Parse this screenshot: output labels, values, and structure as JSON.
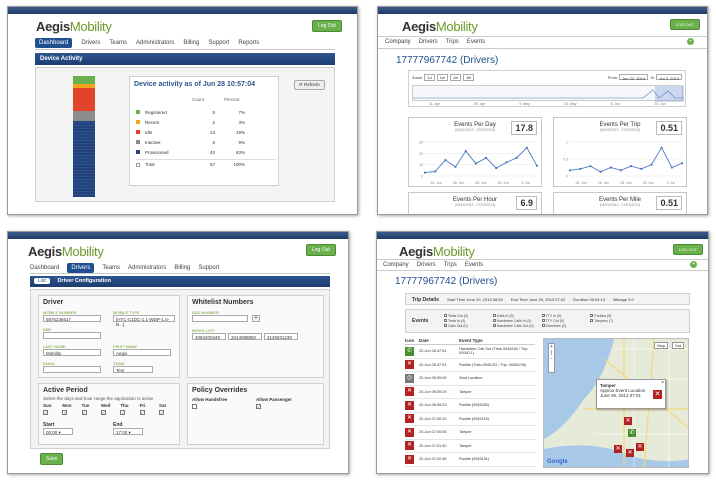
{
  "p1": {
    "brand_a": "Aegis",
    "brand_b": "Mobility",
    "logout": "Log Out",
    "nav": [
      "Dashboard",
      "Drivers",
      "Teams",
      "Administrators",
      "Billing",
      "Support",
      "Reports"
    ],
    "section": "Device Activity",
    "heading": "Device activity as of Jun 28 10:57:04",
    "refresh": "Refresh",
    "col_count": "Count",
    "col_percent": "Percent",
    "rows": [
      {
        "label": "Registered",
        "count": "5",
        "pct": "7%",
        "color": "#6ab04c"
      },
      {
        "label": "Recent",
        "count": "2",
        "pct": "3%",
        "color": "#f2a51c"
      },
      {
        "label": "Idle",
        "count": "13",
        "pct": "19%",
        "color": "#e0452b"
      },
      {
        "label": "Inactive",
        "count": "6",
        "pct": "9%",
        "color": "#8c8c8c"
      },
      {
        "label": "Provisioned",
        "count": "42",
        "pct": "63%",
        "color": "#23427a"
      }
    ],
    "total_label": "Total",
    "total_count": "67",
    "total_pct": "100%"
  },
  "p2": {
    "brand_a": "Aegis",
    "brand_b": "Mobility",
    "logout": "LOG OUT",
    "nav": [
      "Company",
      "Drivers",
      "Trips",
      "Events"
    ],
    "title": "17777967742 (Drivers)",
    "zoom_label": "Zoom",
    "zoom_opts": [
      "1d",
      "1w",
      "1m",
      "All"
    ],
    "from_label": "From",
    "from_val": "Jun 22, 2013",
    "to_label": "To",
    "to_val": "Jul 3, 2013",
    "timeline_ticks": [
      "11. Apr",
      "25. Apr",
      "9. May",
      "23. May",
      "6. Jun",
      "20. Jun"
    ],
    "cards": [
      {
        "title": "Events Per Day",
        "sub": "(06/22/2013 - 07/03/2013)",
        "value": "17.8"
      },
      {
        "title": "Events Per Trip",
        "sub": "(06/22/2013 - 07/03/2013)",
        "value": "0.51"
      },
      {
        "title": "Events Per Hour",
        "sub": "(06/22/2013 - 07/03/2013)",
        "value": "6.9"
      },
      {
        "title": "Events Per Mile",
        "sub": "(06/22/2013 - 07/03/2013)",
        "value": "0.51"
      }
    ],
    "chart1_xticks": [
      "24. Jun",
      "26. Jun",
      "28. Jun",
      "30. Jun",
      "2. Jul"
    ],
    "chart2_xticks": [
      "24. Jun",
      "26. Jun",
      "28. Jun",
      "30. Jun",
      "2. Jul"
    ],
    "chart1_yticks": [
      "30",
      "20",
      "10",
      "0"
    ],
    "chart2_yticks": [
      "1",
      "0.5",
      "0"
    ]
  },
  "p3": {
    "brand_a": "Aegis",
    "brand_b": "Mobility",
    "logout": "Log Out",
    "nav": [
      "Dashboard",
      "Drivers",
      "Teams",
      "Administrators",
      "Billing",
      "Support"
    ],
    "tab_list": "List",
    "tab_config": "Driver Configuration",
    "driver_head": "Driver",
    "mobile_number_label": "Mobile Number",
    "mobile_number": "5875236617",
    "mobile_type_label": "Mobile Type",
    "mobile_type": "[HTC-C1DC-1.1-WDP-1.5-B...]",
    "imei_label": "IMEI",
    "imei": "",
    "last_name_label": "Last Name",
    "last_name": "Mobility",
    "first_name_label": "First Name",
    "first_name": "Aegis",
    "email_label": "Email",
    "email": "",
    "team_label": "Team",
    "team": "Test",
    "whitelist_head": "Whitelist Numbers",
    "add_number_label": "Add Number",
    "white_list_label": "White List",
    "white_list": [
      "4084200349",
      "3314098882",
      "3125831230"
    ],
    "active_head": "Active Period",
    "active_desc": "Select the days and hour range the application is active",
    "days": [
      "Sun",
      "Mon",
      "Tue",
      "Wed",
      "Thu",
      "Fri",
      "Sat"
    ],
    "start_label": "Start",
    "start_val": "00:00",
    "end_label": "End",
    "end_val": "17:00",
    "policy_head": "Policy Overrides",
    "allow_handsfree": "Allow Handsfree",
    "allow_passenger": "Allow Passenger",
    "save": "Save"
  },
  "p4": {
    "brand_a": "Aegis",
    "brand_b": "Mobility",
    "logout": "LOG OUT",
    "nav": [
      "Company",
      "Drivers",
      "Trips",
      "Events"
    ],
    "title": "17777967742 (Drivers)",
    "trip_details": "Trip Details",
    "start_time": "Start Time June 20, 2013 08:59",
    "end_time": "End Time June 20, 2013 07:02",
    "duration": "Duration 00:04:13",
    "mileage": "Mileage 5.0",
    "events_label": "Events",
    "filters": [
      "Texts Out (0)",
      "Texts In (0)",
      "Calls Out (0)",
      "Calls In (0)",
      "Handsfree Calls In (0)",
      "Handsfree Calls Out (0)",
      "TTY In (0)",
      "TTY Out (0)",
      "Overrides (0)",
      "Parkins (0)",
      "Tampers (7)"
    ],
    "cols": [
      "Icon",
      "Date",
      "Event Type"
    ],
    "events": [
      {
        "date": "20-Jun 06:47:51",
        "type": "Handsfree Call Out (Trisk-0545245 / Trip: 00060.1)",
        "icon": "#4a8f2f"
      },
      {
        "date": "20-Jun 06:47:51",
        "type": "Paddle (Trisk-0545-0G / Trip: 00060.06)",
        "icon": "#b22222"
      },
      {
        "date": "20-Jun 06:59:08",
        "type": "Start Location",
        "icon": "#777"
      },
      {
        "date": "20-Jun 06:59:29",
        "type": "Tamper",
        "icon": "#b22222"
      },
      {
        "date": "20-Jun 06:59:23",
        "type": "Paddle (0545052)",
        "icon": "#b22222"
      },
      {
        "date": "20-Jun 07:00:42",
        "type": "Paddle (0545115)",
        "icon": "#b22222"
      },
      {
        "date": "20-Jun 07:00:55",
        "type": "Tamper",
        "icon": "#b22222"
      },
      {
        "date": "20-Jun 07:01:40",
        "type": "Tamper",
        "icon": "#b22222"
      },
      {
        "date": "20-Jun 07:02:48",
        "type": "Paddle (0545131)",
        "icon": "#b22222"
      }
    ],
    "map_popup_title": "Tamper",
    "map_popup_line1": "Approx Event Location",
    "map_popup_line2": "June 06, 2013 07:01",
    "map_logo": "Google",
    "map_btn_map": "Map",
    "map_btn_sat": "Sat"
  },
  "colors": {
    "brand_blue": "#1f4f8f",
    "brand_green": "#6ab04c",
    "alert_red": "#b22222"
  },
  "chart_data": [
    {
      "type": "line",
      "title": "Events Per Day",
      "x": [
        "22-Jun",
        "23-Jun",
        "24-Jun",
        "25-Jun",
        "26-Jun",
        "27-Jun",
        "28-Jun",
        "29-Jun",
        "30-Jun",
        "1-Jul",
        "2-Jul",
        "3-Jul"
      ],
      "series": [
        {
          "values": [
            3,
            4,
            14,
            8,
            22,
            11,
            16,
            7,
            12,
            16,
            25,
            9
          ]
        }
      ],
      "ylim": [
        0,
        30
      ]
    },
    {
      "type": "line",
      "title": "Events Per Trip",
      "x": [
        "22-Jun",
        "23-Jun",
        "24-Jun",
        "25-Jun",
        "26-Jun",
        "27-Jun",
        "28-Jun",
        "29-Jun",
        "30-Jun",
        "1-Jul",
        "2-Jul",
        "3-Jul"
      ],
      "series": [
        {
          "values": [
            0.2,
            0.25,
            0.35,
            0.15,
            0.3,
            0.2,
            0.35,
            0.25,
            0.4,
            1.0,
            0.3,
            0.45
          ]
        }
      ],
      "ylim": [
        0,
        1.2
      ]
    }
  ]
}
